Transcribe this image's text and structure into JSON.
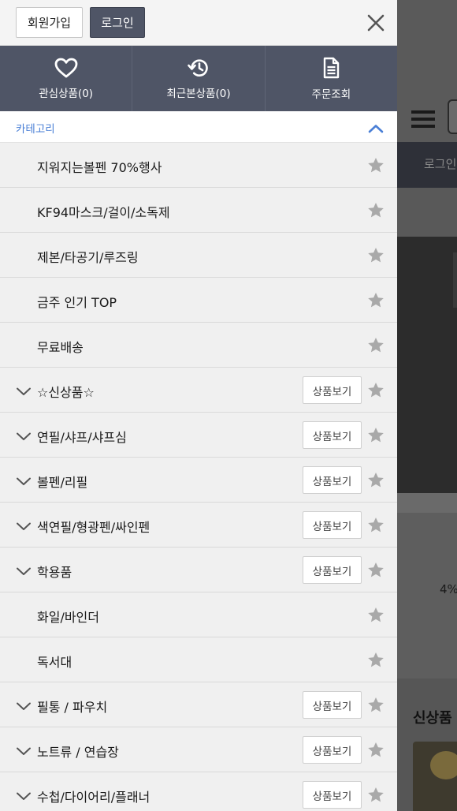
{
  "drawer": {
    "join_label": "회원가입",
    "login_label": "로그인",
    "quick_links": [
      {
        "label": "관심상품(0)",
        "icon": "heart-icon"
      },
      {
        "label": "최근본상품(0)",
        "icon": "history-icon"
      },
      {
        "label": "주문조회",
        "icon": "document-icon"
      }
    ],
    "category_title": "카테고리",
    "categories": [
      {
        "label": "지워지는볼펜 70%행사",
        "expandable": false
      },
      {
        "label": "KF94마스크/걸이/소독제",
        "expandable": false
      },
      {
        "label": "제본/타공기/루즈링",
        "expandable": false
      },
      {
        "label": "금주 인기 TOP",
        "expandable": false
      },
      {
        "label": "무료배송",
        "expandable": false
      },
      {
        "label": "☆신상품☆",
        "expandable": true
      },
      {
        "label": "연필/샤프/샤프심",
        "expandable": true
      },
      {
        "label": "볼펜/리필",
        "expandable": true
      },
      {
        "label": "색연필/형광펜/싸인펜",
        "expandable": true
      },
      {
        "label": "학용품",
        "expandable": true
      },
      {
        "label": "화일/바인더",
        "expandable": false
      },
      {
        "label": "독서대",
        "expandable": false
      },
      {
        "label": "필통 / 파우치",
        "expandable": true
      },
      {
        "label": "노트류 / 연습장",
        "expandable": true
      },
      {
        "label": "수첩/다이어리/플래너",
        "expandable": true
      }
    ],
    "view_products_label": "상품보기"
  },
  "background": {
    "login_text": "로그인",
    "percent_text": "4%",
    "new_products_text": "신상품"
  },
  "colors": {
    "accent_blue": "#4a7fd6",
    "bar_dark": "#4f5566",
    "star_grey": "#a9a9a9"
  }
}
